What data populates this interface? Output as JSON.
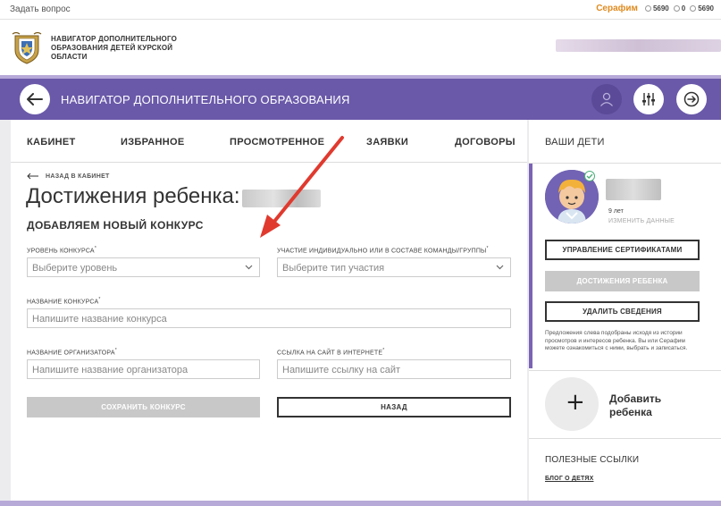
{
  "topbar": {
    "ask_label": "Задать вопрос",
    "currency_name": "Серафим",
    "balances": [
      "5690",
      "0",
      "5690"
    ]
  },
  "header": {
    "brand_lines": [
      "НАВИГАТОР ДОПОЛНИТЕЛЬНОГО",
      "ОБРАЗОВАНИЯ ДЕТЕЙ КУРСКОЙ",
      "ОБЛАСТИ"
    ]
  },
  "nav": {
    "title": "НАВИГАТОР ДОПОЛНИТЕЛЬНОГО ОБРАЗОВАНИЯ"
  },
  "tabs": [
    "КАБИНЕТ",
    "ИЗБРАННОЕ",
    "ПРОСМОТРЕННОЕ",
    "ЗАЯВКИ",
    "ДОГОВОРЫ"
  ],
  "page": {
    "back_link": "НАЗАД В КАБИНЕТ",
    "title": "Достижения ребенка:",
    "subtitle": "ДОБАВЛЯЕМ НОВЫЙ КОНКУРС"
  },
  "form": {
    "level_label": "УРОВЕНЬ КОНКУРСА",
    "level_placeholder": "Выберите уровень",
    "participation_label": "УЧАСТИЕ ИНДИВИДУАЛЬНО ИЛИ В СОСТАВЕ КОМАНДЫ/ГРУППЫ",
    "participation_placeholder": "Выберите тип участия",
    "name_label": "НАЗВАНИЕ КОНКУРСА",
    "name_placeholder": "Напишите название конкурса",
    "organizer_label": "НАЗВАНИЕ ОРГАНИЗАТОРА",
    "organizer_placeholder": "Напишите название организатора",
    "link_label": "ССЫЛКА НА САЙТ В ИНТЕРНЕТЕ",
    "link_placeholder": "Напишите ссылку на сайт",
    "required_mark": "*",
    "save_label": "СОХРАНИТЬ КОНКУРС",
    "back_label": "НАЗАД"
  },
  "side": {
    "kids_heading": "ВАШИ ДЕТИ",
    "child_age": "9 лет",
    "edit_label": "ИЗМЕНИТЬ ДАННЫЕ",
    "cert_button": "УПРАВЛЕНИЕ СЕРТИФИКАТАМИ",
    "achievements_button": "ДОСТИЖЕНИЯ РЕБЕНКА",
    "delete_button": "УДАЛИТЬ СВЕДЕНИЯ",
    "note": "Предложения слева подобраны исходя из истории просмотров и интересов ребенка. Вы или Серафим можете ознакомиться с ними, выбрать и записаться.",
    "add_child_lines": [
      "Добавить",
      "ребенка"
    ],
    "links_heading": "ПОЛЕЗНЫЕ ССЫЛКИ",
    "blog_link": "БЛОГ О ДЕТЯХ"
  },
  "colors": {
    "purple": "#6a59a9",
    "accent_orange": "#e08a1e",
    "arrow_red": "#e03a2f"
  }
}
